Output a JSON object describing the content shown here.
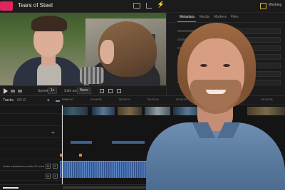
{
  "app": {
    "title": "Tears of Steel",
    "workspace": "Working",
    "colors": {
      "accent": "#e0245e",
      "selection": "#5a9bd5",
      "audio": "#3f67a6",
      "marker": "#e48a2b"
    }
  },
  "inspector": {
    "tabs": [
      "Metadata",
      "Media",
      "Markers",
      "Files"
    ],
    "active_tab": "Metadata"
  },
  "viewer_controls": {
    "speed_label": "Speed",
    "speed_value": "1x",
    "safe_label": "Safe area",
    "safe_value": "None"
  },
  "timeline": {
    "tracks_label": "Tracks",
    "track_count": "86/12",
    "ruler_ticks": [
      "00:00:00",
      "00:00:05",
      "00:00:10",
      "00:00:15",
      "00:00:20",
      "00:00:25",
      "00:00:30",
      "00:00:35"
    ],
    "audio_track_label": "Audio track/stereo audio 01 mixer (2 ch)",
    "mute_label": "M",
    "solo_label": "S"
  },
  "icons": [
    "app-logo-icon",
    "monitor-icon",
    "share-icon",
    "bolt-icon",
    "play-icon",
    "funnel-icon",
    "marker-icon",
    "zoom-out-icon",
    "plus-icon"
  ]
}
